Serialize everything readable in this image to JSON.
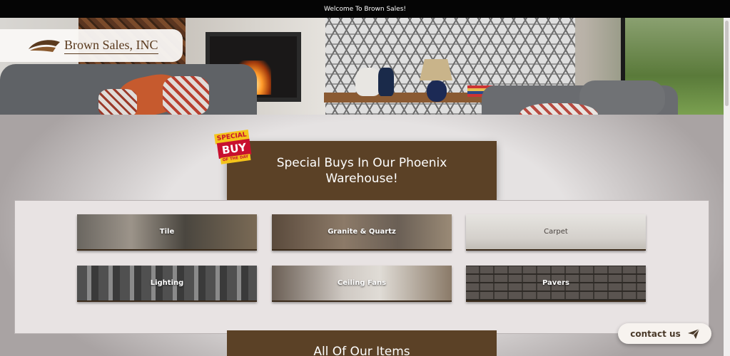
{
  "topbar": {
    "welcome_text": "Welcome To Brown Sales!"
  },
  "logo": {
    "text": "Brown Sales, INC"
  },
  "badge": {
    "line1": "SPECIAL",
    "line2": "BUY",
    "line3": "OF THE DAY"
  },
  "special_section": {
    "heading": "Special Buys In Our Phoenix Warehouse!"
  },
  "categories": [
    {
      "label": "Tile"
    },
    {
      "label": "Granite & Quartz"
    },
    {
      "label": "Carpet"
    },
    {
      "label": "Lighting"
    },
    {
      "label": "Ceiling Fans"
    },
    {
      "label": "Pavers"
    }
  ],
  "all_items_section": {
    "heading": "All Of Our Items"
  },
  "contact": {
    "label": "contact us",
    "icon": "paper-plane-icon"
  },
  "colors": {
    "brand_brown": "#5b4126",
    "topbar_bg": "#050505",
    "page_bg": "#e2dfdf"
  }
}
